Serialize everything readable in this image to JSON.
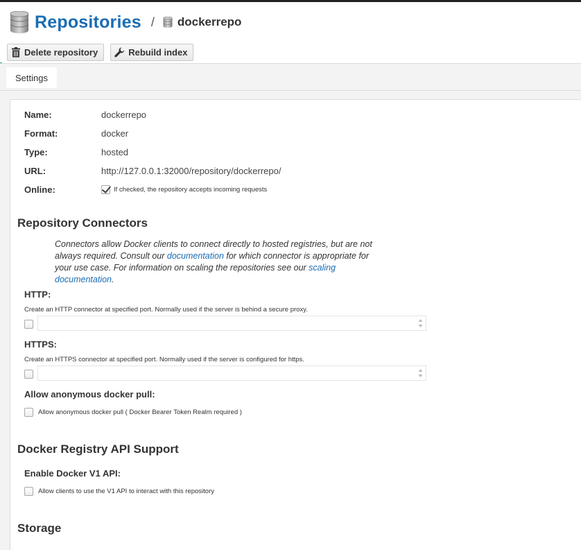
{
  "header": {
    "title": "Repositories",
    "separator": "/",
    "repo_name": "dockerrepo"
  },
  "toolbar": {
    "delete_label": "Delete repository",
    "rebuild_label": "Rebuild index"
  },
  "tabs": [
    {
      "label": "Settings"
    }
  ],
  "details": {
    "name_label": "Name:",
    "name_value": "dockerrepo",
    "format_label": "Format:",
    "format_value": "docker",
    "type_label": "Type:",
    "type_value": "hosted",
    "url_label": "URL:",
    "url_value": "http://127.0.0.1:32000/repository/dockerrepo/",
    "online_label": "Online:",
    "online_checked": true,
    "online_help": "If checked, the repository accepts incoming requests"
  },
  "connectors": {
    "heading": "Repository Connectors",
    "desc_part1": "Connectors allow Docker clients to connect directly to hosted registries, but are not always required. Consult our ",
    "desc_link1": "documentation",
    "desc_part2": " for which connector is appropriate for your use case. For information on scaling the repositories see our ",
    "desc_link2": "scaling documentation",
    "desc_part3": ".",
    "http_label": "HTTP:",
    "http_help": "Create an HTTP connector at specified port. Normally used if the server is behind a secure proxy.",
    "http_checked": false,
    "http_value": "",
    "https_label": "HTTPS:",
    "https_help": "Create an HTTPS connector at specified port. Normally used if the server is configured for https.",
    "https_checked": false,
    "https_value": "",
    "anon_label": "Allow anonymous docker pull:",
    "anon_checked": false,
    "anon_help": "Allow anonymous docker pull ( Docker Bearer Token Realm required )"
  },
  "api_support": {
    "heading": "Docker Registry API Support",
    "v1_label": "Enable Docker V1 API:",
    "v1_checked": false,
    "v1_help": "Allow clients to use the V1 API to interact with this repository"
  },
  "storage": {
    "heading": "Storage"
  },
  "colors": {
    "brand_blue": "#1a6db3",
    "accent_green": "#2db45d",
    "background_gray": "#f3f3f3"
  },
  "icons": {
    "title_icon": "database-icon",
    "repo_icon": "database-icon",
    "delete_icon": "trash-icon",
    "rebuild_icon": "wrench-icon"
  }
}
